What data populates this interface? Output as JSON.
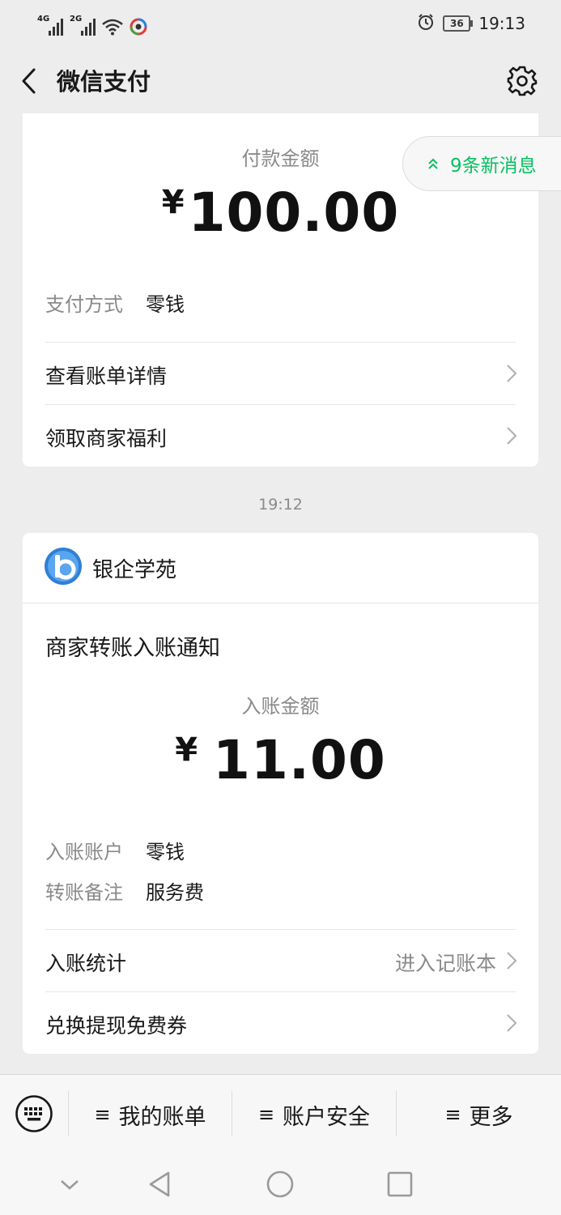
{
  "status_bar": {
    "net1": "4G",
    "net2": "2G",
    "battery": "36",
    "time": "19:13"
  },
  "header": {
    "title": "微信支付",
    "icons": {
      "back": "chevron-left-icon",
      "settings": "gear-icon"
    }
  },
  "new_messages": {
    "label": "9条新消息",
    "icon": "double-chevron-up-icon"
  },
  "payment_card": {
    "amount_label": "付款金额",
    "currency": "¥",
    "amount": "100.00",
    "method_key": "支付方式",
    "method_value": "零钱",
    "rows": [
      {
        "label": "查看账单详情"
      },
      {
        "label": "领取商家福利"
      }
    ]
  },
  "time_separator": "19:12",
  "transfer_card": {
    "merchant_name": "银企学苑",
    "notice_title": "商家转账入账通知",
    "amount_label": "入账金额",
    "currency": "¥",
    "amount": "11.00",
    "account_key": "入账账户",
    "account_value": "零钱",
    "remark_key": "转账备注",
    "remark_value": "服务费",
    "rows": [
      {
        "label": "入账统计",
        "extra": "进入记账本"
      },
      {
        "label": "兑换提现免费券"
      }
    ]
  },
  "bottom_menu": {
    "ham": "≡",
    "items": [
      {
        "label": "我的账单"
      },
      {
        "label": "账户安全"
      },
      {
        "label": "更多"
      }
    ]
  },
  "colors": {
    "background": "#ededed",
    "accent_green": "#07c160",
    "card": "#ffffff",
    "muted_text": "#8a8a8a"
  }
}
